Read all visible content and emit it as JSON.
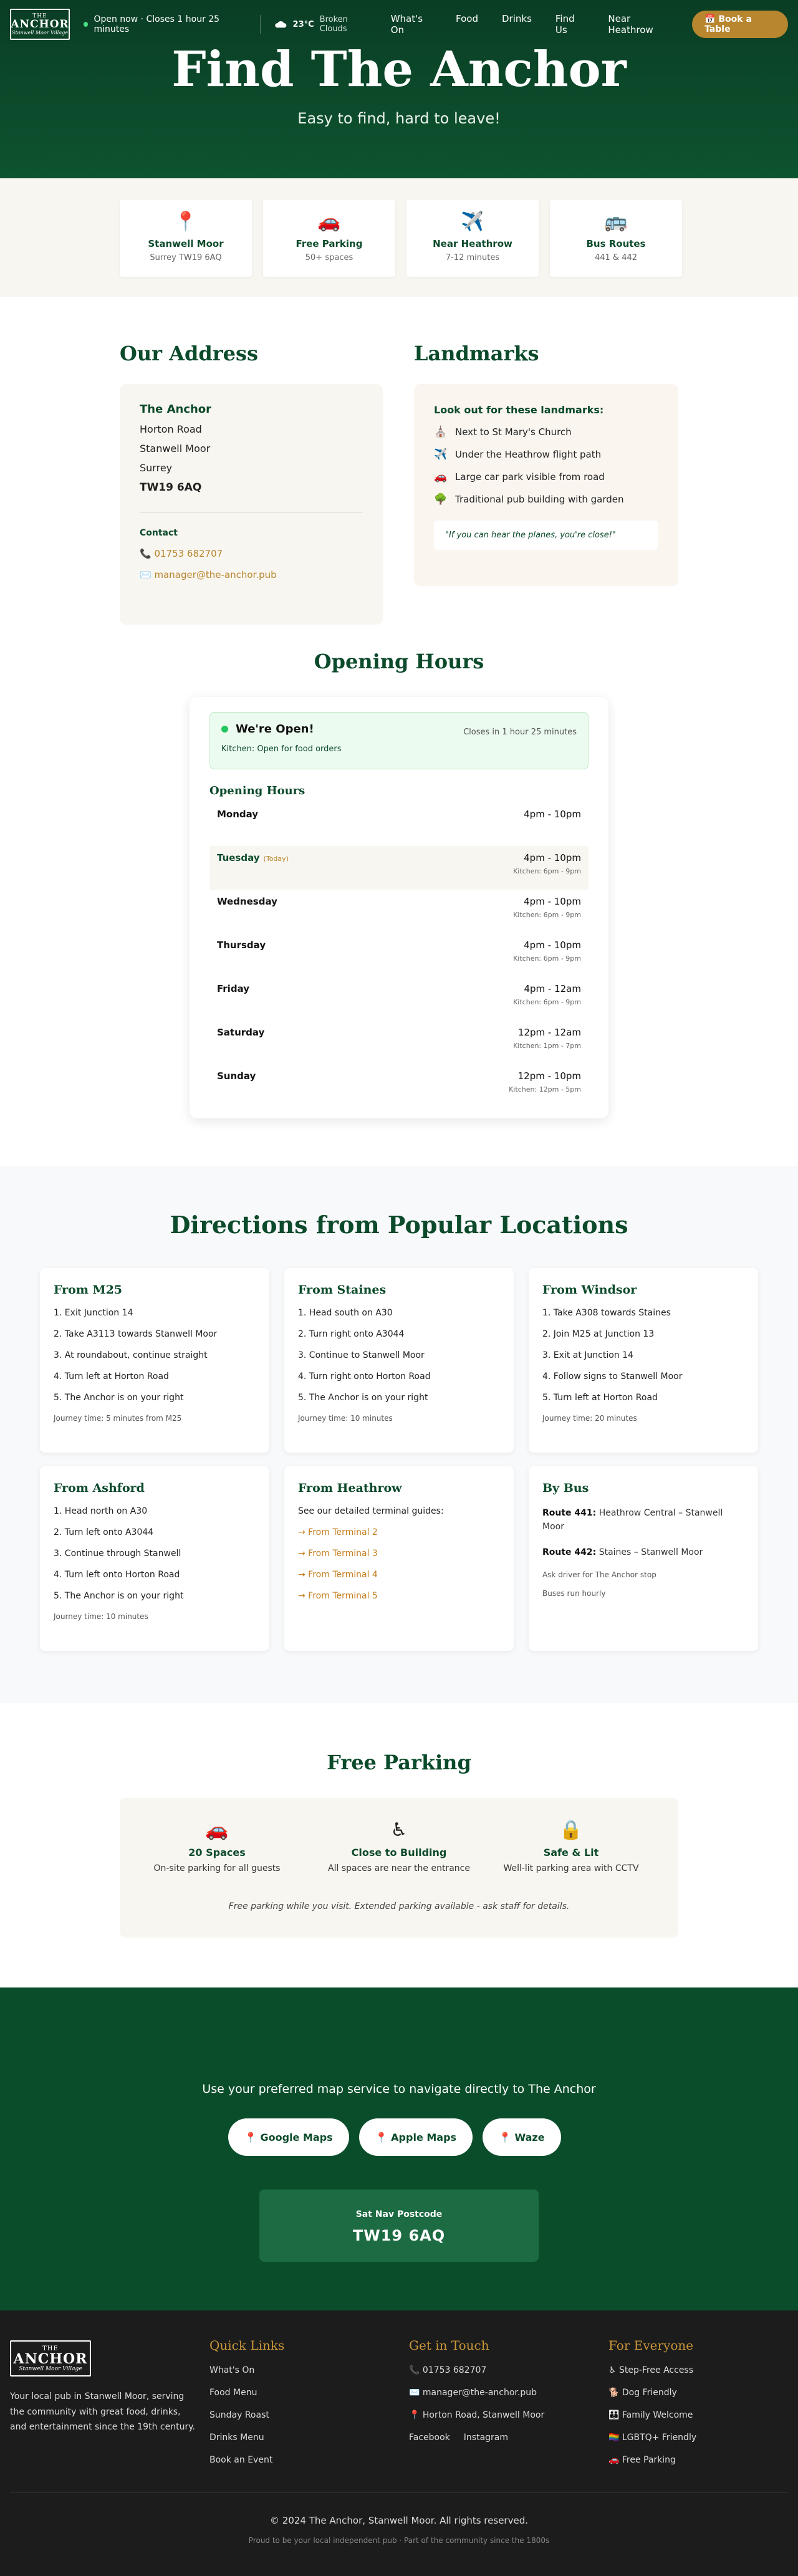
{
  "nav": {
    "logo": {
      "top": "THE",
      "main": "ANCHOR",
      "script": "Stanwell Moor Village"
    },
    "status": "Open now · Closes 1 hour 25 minutes",
    "weather": {
      "temp": "23°C",
      "condition": "Broken Clouds"
    },
    "links": [
      "What's On",
      "Food",
      "Drinks",
      "Find Us",
      "Near Heathrow"
    ],
    "book_label": "📅 Book a Table"
  },
  "hero": {
    "title": "Find The Anchor",
    "subtitle": "Easy to find, hard to leave!"
  },
  "info_cards": [
    {
      "icon": "📍",
      "icon_name": "pin-icon",
      "title": "Stanwell Moor",
      "sub": "Surrey TW19 6AQ"
    },
    {
      "icon": "🚗",
      "icon_name": "car-icon",
      "title": "Free Parking",
      "sub": "50+ spaces"
    },
    {
      "icon": "✈️",
      "icon_name": "plane-icon",
      "title": "Near Heathrow",
      "sub": "7-12 minutes"
    },
    {
      "icon": "🚌",
      "icon_name": "bus-icon",
      "title": "Bus Routes",
      "sub": "441 & 442"
    }
  ],
  "address": {
    "heading": "Our Address",
    "name": "The Anchor",
    "lines": [
      "Horton Road",
      "Stanwell Moor",
      "Surrey"
    ],
    "postcode": "TW19 6AQ",
    "contact_heading": "Contact",
    "phone": "📞 01753 682707",
    "email": "✉️ manager@the-anchor.pub"
  },
  "landmarks": {
    "heading": "Landmarks",
    "subheading": "Look out for these landmarks:",
    "items": [
      {
        "icon": "⛪",
        "icon_name": "church-icon",
        "text": "Next to St Mary's Church"
      },
      {
        "icon": "✈️",
        "icon_name": "plane-icon",
        "text": "Under the Heathrow flight path"
      },
      {
        "icon": "🚗",
        "icon_name": "car-icon",
        "text": "Large car park visible from road"
      },
      {
        "icon": "🌳",
        "icon_name": "tree-icon",
        "text": "Traditional pub building with garden"
      }
    ],
    "quote": "\"If you can hear the planes, you're close!\""
  },
  "hours": {
    "heading": "Opening Hours",
    "status": "We're Open!",
    "closes": "Closes in 1 hour 25 minutes",
    "kitchen": "Kitchen: Open for food orders",
    "table_heading": "Opening Hours",
    "today_tag": "(Today)",
    "days": [
      {
        "day": "Monday",
        "hours": "4pm - 10pm",
        "kitchen": ""
      },
      {
        "day": "Tuesday",
        "hours": "4pm - 10pm",
        "kitchen": "Kitchen: 6pm - 9pm",
        "today": true
      },
      {
        "day": "Wednesday",
        "hours": "4pm - 10pm",
        "kitchen": "Kitchen: 6pm - 9pm"
      },
      {
        "day": "Thursday",
        "hours": "4pm - 10pm",
        "kitchen": "Kitchen: 6pm - 9pm"
      },
      {
        "day": "Friday",
        "hours": "4pm - 12am",
        "kitchen": "Kitchen: 6pm - 9pm"
      },
      {
        "day": "Saturday",
        "hours": "12pm - 12am",
        "kitchen": "Kitchen: 1pm - 7pm"
      },
      {
        "day": "Sunday",
        "hours": "12pm - 10pm",
        "kitchen": "Kitchen: 12pm - 5pm"
      }
    ]
  },
  "directions": {
    "heading": "Directions from Popular Locations",
    "cards": [
      {
        "title": "From M25",
        "steps": [
          "1. Exit Junction 14",
          "2. Take A3113 towards Stanwell Moor",
          "3. At roundabout, continue straight",
          "4. Turn left at Horton Road",
          "5. The Anchor is on your right"
        ],
        "journey": "Journey time: 5 minutes from M25"
      },
      {
        "title": "From Staines",
        "steps": [
          "1. Head south on A30",
          "2. Turn right onto A3044",
          "3. Continue to Stanwell Moor",
          "4. Turn right onto Horton Road",
          "5. The Anchor is on your right"
        ],
        "journey": "Journey time: 10 minutes"
      },
      {
        "title": "From Windsor",
        "steps": [
          "1. Take A308 towards Staines",
          "2. Join M25 at Junction 13",
          "3. Exit at Junction 14",
          "4. Follow signs to Stanwell Moor",
          "5. Turn left at Horton Road"
        ],
        "journey": "Journey time: 20 minutes"
      },
      {
        "title": "From Ashford",
        "steps": [
          "1. Head north on A30",
          "2. Turn left onto A3044",
          "3. Continue through Stanwell",
          "4. Turn left onto Horton Road",
          "5. The Anchor is on your right"
        ],
        "journey": "Journey time: 10 minutes"
      }
    ],
    "heathrow": {
      "title": "From Heathrow",
      "intro": "See our detailed terminal guides:",
      "links": [
        "→ From Terminal 2",
        "→ From Terminal 3",
        "→ From Terminal 4",
        "→ From Terminal 5"
      ]
    },
    "bus": {
      "title": "By Bus",
      "routes": [
        {
          "label": "Route 441:",
          "text": " Heathrow Central – Stanwell Moor"
        },
        {
          "label": "Route 442:",
          "text": " Staines – Stanwell Moor"
        }
      ],
      "notes": [
        "Ask driver for The Anchor stop",
        "Buses run hourly"
      ]
    }
  },
  "parking": {
    "heading": "Free Parking",
    "items": [
      {
        "icon": "🚗",
        "icon_name": "car-icon",
        "title": "20 Spaces",
        "text": "On-site parking for all guests"
      },
      {
        "icon": "♿",
        "icon_name": "wheelchair-icon",
        "title": "Close to Building",
        "text": "All spaces are near the entrance"
      },
      {
        "icon": "🔒",
        "icon_name": "lock-icon",
        "title": "Safe & Lit",
        "text": "Well-lit parking area with CCTV"
      }
    ],
    "note": "Free parking while you visit. Extended parking available - ask staff for details."
  },
  "maps": {
    "intro": "Use your preferred map service to navigate directly to The Anchor",
    "buttons": [
      "📍 Google Maps",
      "📍 Apple Maps",
      "📍 Waze"
    ],
    "satnav_label": "Sat Nav Postcode",
    "satnav_value": "TW19 6AQ"
  },
  "footer": {
    "logo": {
      "top": "THE",
      "main": "ANCHOR",
      "script": "Stanwell Moor Village"
    },
    "about": "Your local pub in Stanwell Moor, serving the community with great food, drinks, and entertainment since the 19th century.",
    "quick_heading": "Quick Links",
    "quick_links": [
      "What's On",
      "Food Menu",
      "Sunday Roast",
      "Drinks Menu",
      "Book an Event"
    ],
    "touch_heading": "Get in Touch",
    "touch": [
      "📞 01753 682707",
      "✉️ manager@the-anchor.pub",
      "📍 Horton Road, Stanwell Moor"
    ],
    "social": [
      "Facebook",
      "Instagram"
    ],
    "everyone_heading": "For Everyone",
    "everyone": [
      "♿ Step-Free Access",
      "🐕 Dog Friendly",
      "👪 Family Welcome",
      "🏳️‍🌈 LGBTQ+ Friendly",
      "🚗 Free Parking"
    ],
    "copyright": "© 2024 The Anchor, Stanwell Moor. All rights reserved.",
    "tagline": "Proud to be your local independent pub · Part of the community since the 1800s"
  },
  "colors": {
    "primary": "#0b4a2a",
    "accent": "#b8862f",
    "cream": "#f8f6f0",
    "footer": "#1c1c1c"
  }
}
